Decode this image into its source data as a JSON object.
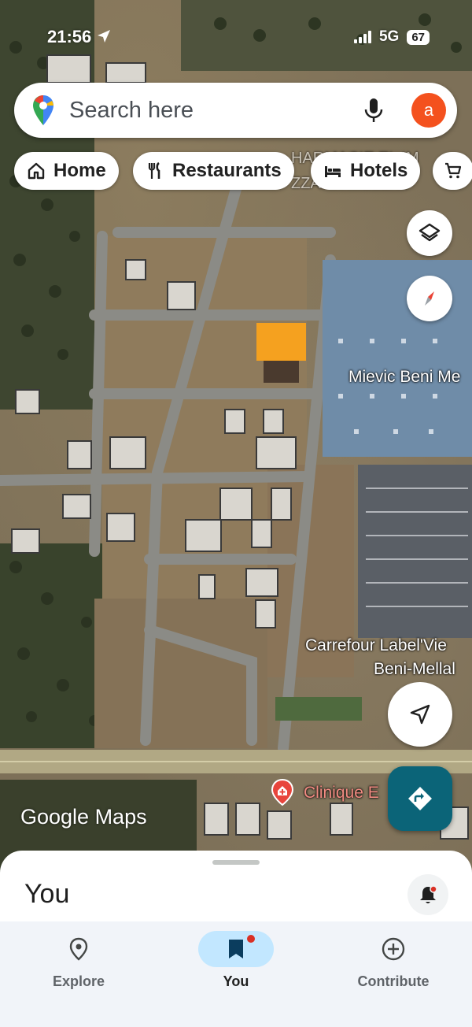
{
  "status_bar": {
    "time": "21:56",
    "network": "5G",
    "battery": "67"
  },
  "search": {
    "placeholder": "Search here",
    "avatar_letter": "a"
  },
  "chips": [
    {
      "label": "Home",
      "icon": "home-icon"
    },
    {
      "label": "Restaurants",
      "icon": "fork-knife-icon"
    },
    {
      "label": "Hotels",
      "icon": "bed-icon"
    },
    {
      "label": "",
      "icon": "shopping-cart-icon"
    }
  ],
  "map": {
    "place_labels": [
      "Mievic Beni Me",
      "Carrefour Label'Vie",
      "Beni-Mellal",
      "Clinique E"
    ],
    "background_text": [
      "HARMACIE EL IM",
      "ZZAHR MELLAL"
    ],
    "watermark": "Google Maps",
    "highlight_color": "#f5a11f",
    "icons": [
      "layers-icon",
      "compass-icon",
      "my-location-icon",
      "directions-icon",
      "hospital-pin-icon"
    ]
  },
  "sheet": {
    "title": "You"
  },
  "nav": {
    "items": [
      {
        "label": "Explore",
        "icon": "location-pin-icon",
        "active": false
      },
      {
        "label": "You",
        "icon": "bookmark-icon",
        "active": true
      },
      {
        "label": "Contribute",
        "icon": "plus-circle-icon",
        "active": false
      }
    ]
  },
  "colors": {
    "directions_button": "#0b6478",
    "avatar": "#f4511e",
    "nav_active_pill": "#c2e7ff",
    "notification_dot": "#d93025"
  }
}
